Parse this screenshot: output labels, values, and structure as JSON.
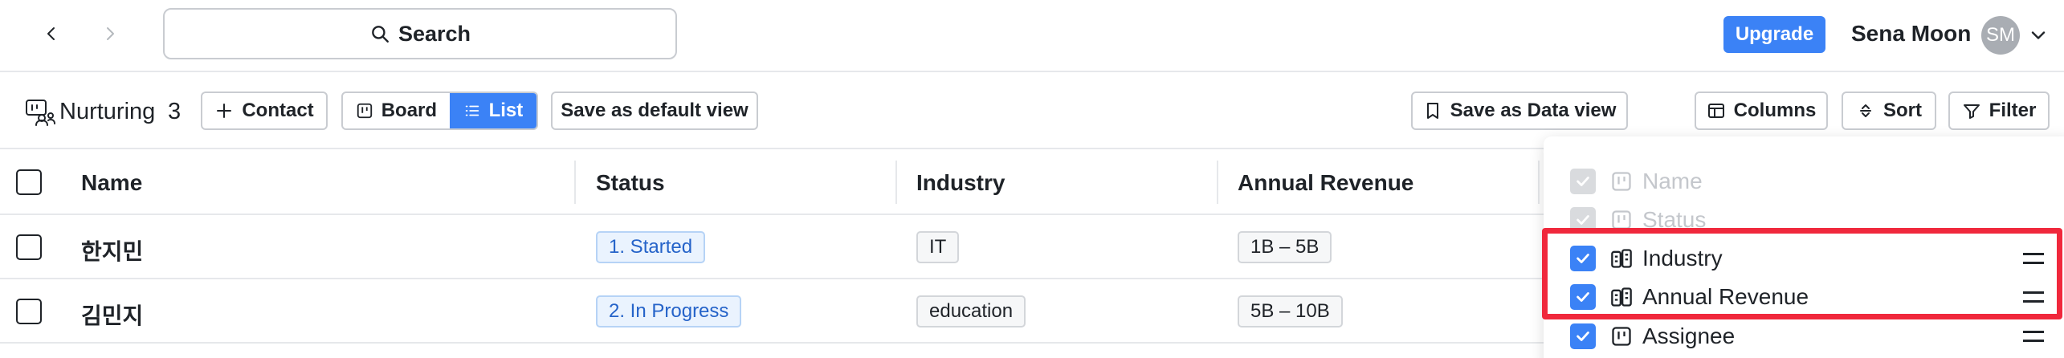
{
  "topbar": {
    "search_label": "Search",
    "upgrade_label": "Upgrade",
    "user_name": "Sena Moon",
    "user_initials": "SM"
  },
  "toolbar": {
    "view_title": "Nurturing",
    "record_count": "3",
    "contact_label": "Contact",
    "board_label": "Board",
    "list_label": "List",
    "save_default_label": "Save as default view",
    "save_data_view_label": "Save as Data view",
    "columns_label": "Columns",
    "sort_label": "Sort",
    "filter_label": "Filter"
  },
  "table": {
    "headers": [
      "Name",
      "Status",
      "Industry",
      "Annual Revenue"
    ],
    "rows": [
      {
        "name": "한지민",
        "status": "1. Started",
        "industry": "IT",
        "revenue": "1B – 5B"
      },
      {
        "name": "김민지",
        "status": "2. In Progress",
        "industry": "education",
        "revenue": "5B – 10B"
      }
    ]
  },
  "columns_menu": {
    "options": [
      {
        "label": "Name",
        "checked": true,
        "disabled": true
      },
      {
        "label": "Status",
        "checked": true,
        "disabled": true
      },
      {
        "label": "Industry",
        "checked": true,
        "disabled": false
      },
      {
        "label": "Annual Revenue",
        "checked": true,
        "disabled": false
      },
      {
        "label": "Assignee",
        "checked": true,
        "disabled": false
      }
    ]
  },
  "colors": {
    "accent": "#3b82f6",
    "highlight": "#f0283c",
    "status_text": "#2563c9"
  },
  "icons": {
    "back": "chevron-left-icon",
    "forward": "chevron-right-icon",
    "search": "search-icon",
    "page": "people-board-icon",
    "add": "plus-icon",
    "board": "board-icon",
    "list": "list-icon",
    "bookmark": "bookmark-icon",
    "columns": "columns-icon",
    "sort": "sort-icon",
    "filter": "filter-icon",
    "drag": "drag-handle-icon"
  }
}
